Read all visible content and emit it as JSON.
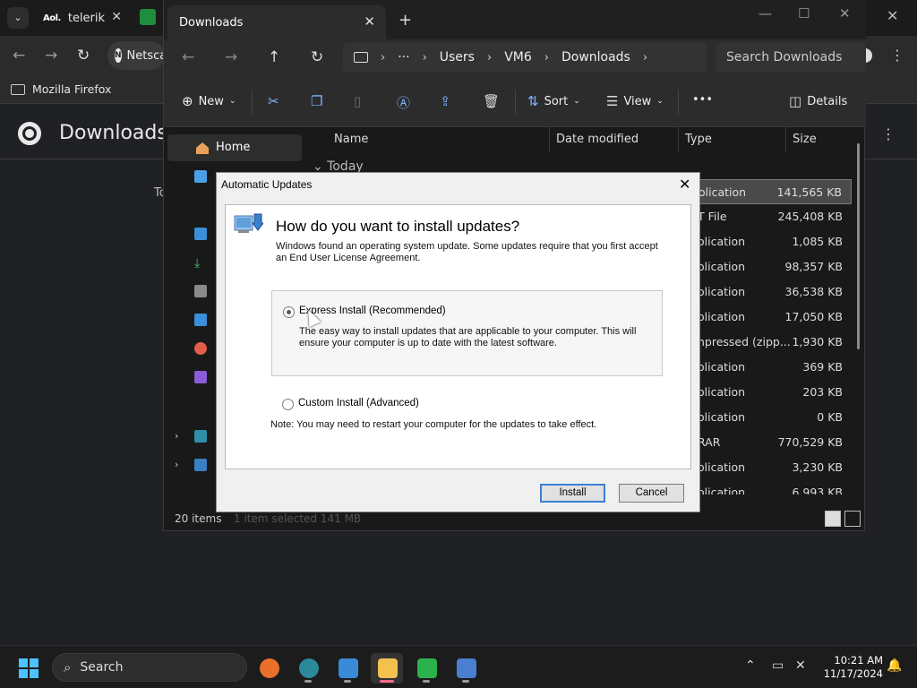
{
  "chrome": {
    "tab1_logo": "Aol.",
    "tab1_title": "telerik",
    "omnibox_text": "Netsca",
    "bookmark": "Mozilla Firefox",
    "page_title": "Downloads",
    "side_text": "To"
  },
  "explorer": {
    "tab_title": "Downloads",
    "breadcrumb": [
      "Users",
      "VM6",
      "Downloads"
    ],
    "ellipsis": "···",
    "search_placeholder": "Search Downloads",
    "commands": {
      "new": "New",
      "sort": "Sort",
      "view": "View",
      "more": "•••",
      "details": "Details"
    },
    "nav_home": "Home",
    "columns": {
      "name": "Name",
      "date": "Date modified",
      "type": "Type",
      "size": "Size"
    },
    "group": "Today",
    "rows": [
      {
        "type": "olication",
        "size": "141,565 KB"
      },
      {
        "type": "T File",
        "size": "245,408 KB"
      },
      {
        "type": "olication",
        "size": "1,085 KB"
      },
      {
        "type": "olication",
        "size": "98,357 KB"
      },
      {
        "type": "olication",
        "size": "36,538 KB"
      },
      {
        "type": "olication",
        "size": "17,050 KB"
      },
      {
        "type": "npressed (zipp...",
        "size": "1,930 KB"
      },
      {
        "type": "olication",
        "size": "369 KB"
      },
      {
        "type": "olication",
        "size": "203 KB"
      },
      {
        "type": "olication",
        "size": "0 KB"
      },
      {
        "type": "RAR",
        "size": "770,529 KB"
      },
      {
        "type": "olication",
        "size": "3,230 KB"
      },
      {
        "type": "olication",
        "size": "6,993 KB"
      }
    ],
    "status_count": "20 items",
    "status_selected": "1 item selected  141 MB"
  },
  "dialog": {
    "title": "Automatic Updates",
    "heading": "How do you want to install updates?",
    "intro": "Windows found an operating system update. Some updates require that you first accept an End User License Agreement.",
    "express_label": "Express Install (Recommended)",
    "express_desc": "The easy way to install updates that are applicable to your computer. This will ensure your computer is up to date with the latest software.",
    "custom_label": "Custom Install (Advanced)",
    "note": "Note: You may need to restart your computer for the updates to take effect.",
    "install_label": "Install",
    "cancel_label": "Cancel"
  },
  "taskbar": {
    "search_label": "Search",
    "time": "10:21 AM",
    "date": "11/17/2024"
  }
}
